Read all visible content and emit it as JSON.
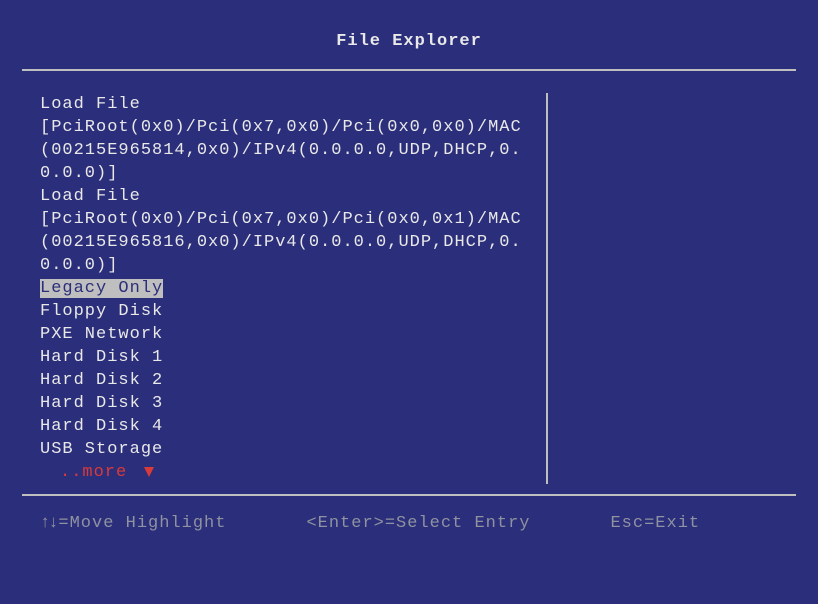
{
  "title": "File Explorer",
  "menu": {
    "items": [
      {
        "label": "Load File",
        "selected": false
      },
      {
        "label": "[PciRoot(0x0)/Pci(0x7,0x0)/Pci(0x0,0x0)/MAC(00215E965814,0x0)/IPv4(0.0.0.0,UDP,DHCP,0.0.0.0)]",
        "selected": false
      },
      {
        "label": "Load File",
        "selected": false
      },
      {
        "label": "[PciRoot(0x0)/Pci(0x7,0x0)/Pci(0x0,0x1)/MAC(00215E965816,0x0)/IPv4(0.0.0.0,UDP,DHCP,0.0.0.0)]",
        "selected": false
      },
      {
        "label": "Legacy Only",
        "selected": true
      },
      {
        "label": "Floppy Disk",
        "selected": false
      },
      {
        "label": "PXE Network",
        "selected": false
      },
      {
        "label": "Hard Disk 1",
        "selected": false
      },
      {
        "label": "Hard Disk 2",
        "selected": false
      },
      {
        "label": "Hard Disk 3",
        "selected": false
      },
      {
        "label": "Hard Disk 4",
        "selected": false
      },
      {
        "label": "USB Storage",
        "selected": false
      }
    ],
    "more_label": "..more"
  },
  "footer": {
    "move": "=Move Highlight",
    "select": "<Enter>=Select Entry",
    "esc": "Esc=Exit"
  }
}
